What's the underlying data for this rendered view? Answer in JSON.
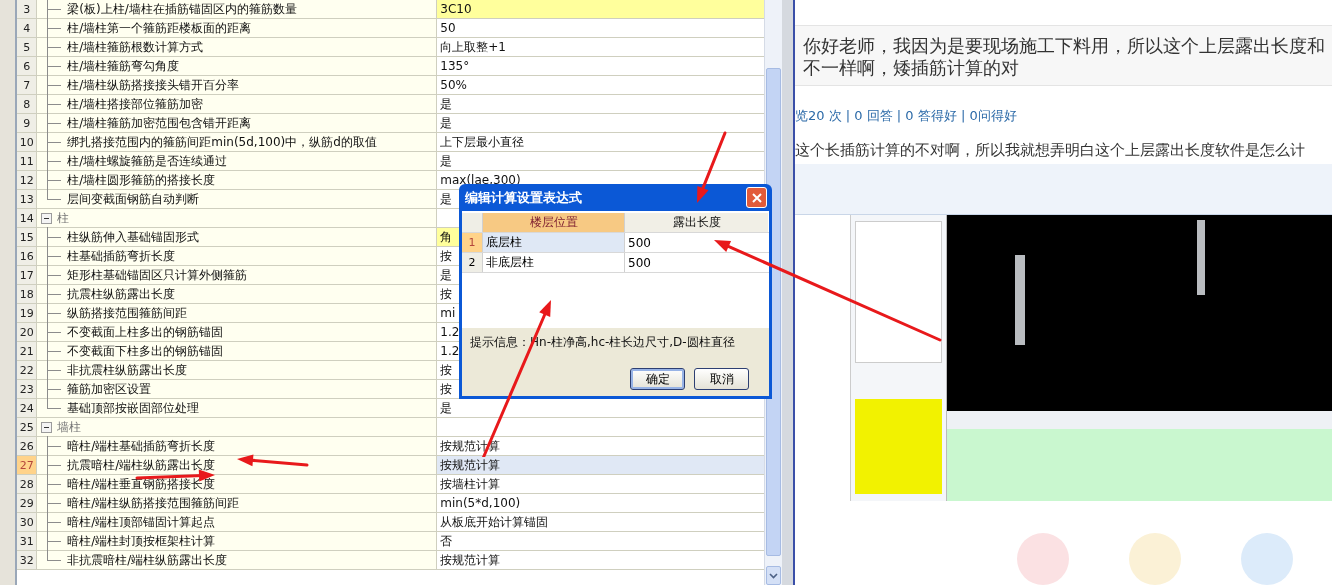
{
  "table": {
    "groups": [
      {
        "children": [
          {
            "number": "3",
            "name": "梁(板)上柱/墙柱在插筋锚固区内的箍筋数量",
            "value": "3C10",
            "highlighted": true,
            "selected": false
          },
          {
            "number": "4",
            "name": "柱/墙柱第一个箍筋距楼板面的距离",
            "value": "50",
            "highlighted": false,
            "selected": false
          },
          {
            "number": "5",
            "name": "柱/墙柱箍筋根数计算方式",
            "value": "向上取整+1",
            "highlighted": false,
            "selected": false
          },
          {
            "number": "6",
            "name": "柱/墙柱箍筋弯勾角度",
            "value": "135°",
            "highlighted": false,
            "selected": false
          },
          {
            "number": "7",
            "name": "柱/墙柱纵筋搭接接头错开百分率",
            "value": "50%",
            "highlighted": false,
            "selected": false
          },
          {
            "number": "8",
            "name": "柱/墙柱搭接部位箍筋加密",
            "value": "是",
            "highlighted": false,
            "selected": false
          },
          {
            "number": "9",
            "name": "柱/墙柱箍筋加密范围包含错开距离",
            "value": "是",
            "highlighted": false,
            "selected": false
          },
          {
            "number": "10",
            "name": "绑扎搭接范围内的箍筋间距min(5d,100)中，纵筋d的取值",
            "value": "上下层最小直径",
            "highlighted": false,
            "selected": false
          },
          {
            "number": "11",
            "name": "柱/墙柱螺旋箍筋是否连续通过",
            "value": "是",
            "highlighted": false,
            "selected": false
          },
          {
            "number": "12",
            "name": "柱/墙柱圆形箍筋的搭接长度",
            "value": "max(lae,300)",
            "highlighted": false,
            "selected": false
          },
          {
            "number": "13",
            "name": "层间变截面钢筋自动判断",
            "value": "是",
            "highlighted": false,
            "selected": false
          }
        ]
      },
      {
        "header": {
          "number": "14",
          "label": "柱",
          "expanded": true
        },
        "children": [
          {
            "number": "15",
            "name": "柱纵筋伸入基础锚固形式",
            "value": "角",
            "highlighted": true,
            "selected": false
          },
          {
            "number": "16",
            "name": "柱基础插筋弯折长度",
            "value": "按",
            "highlighted": false,
            "selected": false
          },
          {
            "number": "17",
            "name": "矩形柱基础锚固区只计算外侧箍筋",
            "value": "是",
            "highlighted": false,
            "selected": false
          },
          {
            "number": "18",
            "name": "抗震柱纵筋露出长度",
            "value": "按",
            "highlighted": false,
            "selected": false
          },
          {
            "number": "19",
            "name": "纵筋搭接范围箍筋间距",
            "value": "mi",
            "highlighted": false,
            "selected": false
          },
          {
            "number": "20",
            "name": "不变截面上柱多出的钢筋锚固",
            "value": "1.2",
            "highlighted": false,
            "selected": false
          },
          {
            "number": "21",
            "name": "不变截面下柱多出的钢筋锚固",
            "value": "1.2",
            "highlighted": false,
            "selected": false
          },
          {
            "number": "22",
            "name": "非抗震柱纵筋露出长度",
            "value": "按",
            "highlighted": false,
            "selected": false
          },
          {
            "number": "23",
            "name": "箍筋加密区设置",
            "value": "按",
            "highlighted": false,
            "selected": false
          },
          {
            "number": "24",
            "name": "基础顶部按嵌固部位处理",
            "value": "是",
            "highlighted": false,
            "selected": false
          }
        ]
      },
      {
        "header": {
          "number": "25",
          "label": "墙柱",
          "expanded": true
        },
        "children": [
          {
            "number": "26",
            "name": "暗柱/端柱基础插筋弯折长度",
            "value": "按规范计算",
            "highlighted": false,
            "selected": false
          },
          {
            "number": "27",
            "name": "抗震暗柱/端柱纵筋露出长度",
            "value": "按规范计算",
            "highlighted": false,
            "selected": true
          },
          {
            "number": "28",
            "name": "暗柱/端柱垂直钢筋搭接长度",
            "value": "按墙柱计算",
            "highlighted": false,
            "selected": false
          },
          {
            "number": "29",
            "name": "暗柱/端柱纵筋搭接范围箍筋间距",
            "value": "min(5*d,100)",
            "highlighted": false,
            "selected": false
          },
          {
            "number": "30",
            "name": "暗柱/端柱顶部锚固计算起点",
            "value": "从板底开始计算锚固",
            "highlighted": false,
            "selected": false
          },
          {
            "number": "31",
            "name": "暗柱/端柱封顶按框架柱计算",
            "value": "否",
            "highlighted": false,
            "selected": false
          },
          {
            "number": "32",
            "name": "非抗震暗柱/端柱纵筋露出长度",
            "value": "按规范计算",
            "highlighted": false,
            "selected": false
          }
        ]
      }
    ]
  },
  "dialog": {
    "title": "编辑计算设置表达式",
    "columns": [
      {
        "label": "楼层位置",
        "selected": true
      },
      {
        "label": "露出长度",
        "selected": false
      }
    ],
    "rows": [
      {
        "number": "1",
        "floor": "底层柱",
        "length": "500",
        "selected": true
      },
      {
        "number": "2",
        "floor": "非底层柱",
        "length": "500",
        "selected": false
      }
    ],
    "hint": "提示信息：Hn-柱净高,hc-柱长边尺寸,D-圆柱直径",
    "buttons": [
      {
        "label": "确定",
        "focused": true
      },
      {
        "label": "取消",
        "focused": false
      }
    ]
  },
  "question": {
    "lines": [
      "你好老师，我因为是要现场施工下料用，所以这个上层露出长度和",
      "不一样啊，矮插筋计算的对"
    ],
    "stats": "览20 次 | 0 回答 | 0 答得好 | 0问得好",
    "answer": "这个长插筋计算的不对啊，所以我就想弄明白这个上层露出长度软件是怎么计"
  }
}
